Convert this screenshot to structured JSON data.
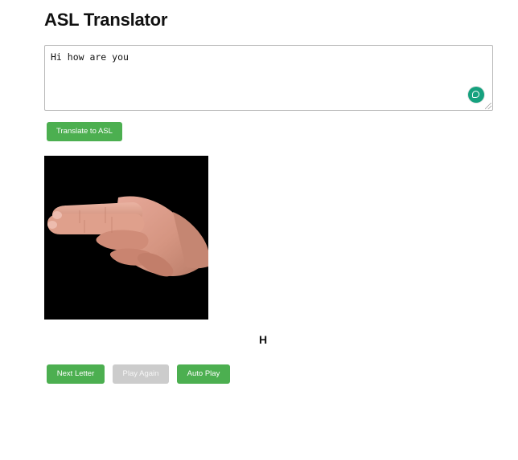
{
  "header": {
    "title": "ASL Translator"
  },
  "input": {
    "value": "Hi how are you",
    "grammar_icon": "grammar-assistant-icon"
  },
  "actions": {
    "translate_label": "Translate to ASL",
    "next_label": "Next Letter",
    "play_again_label": "Play Again",
    "auto_play_label": "Auto Play"
  },
  "display": {
    "current_letter": "H",
    "image_subject": "hand sign for letter H"
  },
  "colors": {
    "primary_button": "#4caf50",
    "disabled_button": "#cccccc",
    "image_background": "#000000"
  }
}
